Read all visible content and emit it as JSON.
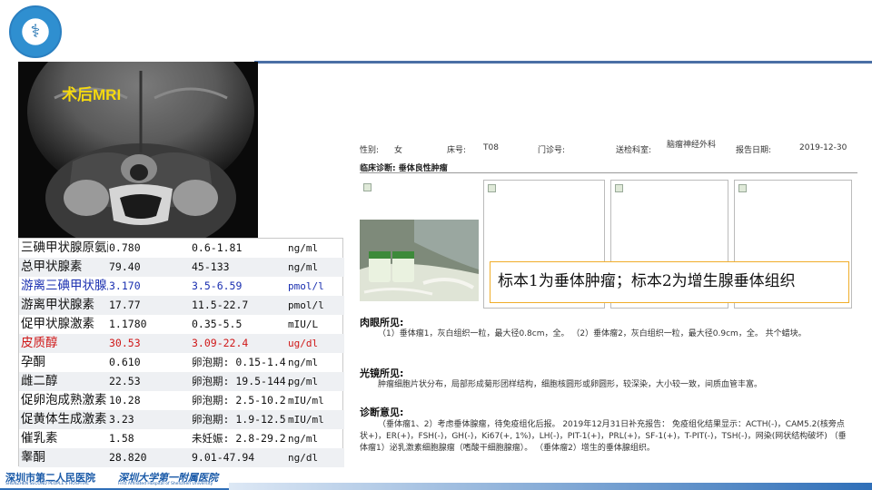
{
  "mri": {
    "title": "术后MRI"
  },
  "lab_rows": [
    {
      "name": "三碘甲状腺原氨酸",
      "value": "0.780",
      "range": "0.6-1.81",
      "unit": "ng/ml",
      "color": "#111111"
    },
    {
      "name": "总甲状腺素",
      "value": "79.40",
      "range": "45-133",
      "unit": "ng/ml",
      "color": "#111111"
    },
    {
      "name": "游离三碘甲状腺原氨酸",
      "value": "3.170",
      "range": "3.5-6.59",
      "unit": "pmol/l",
      "color": "#1a2fb0"
    },
    {
      "name": "游离甲状腺素",
      "value": "17.77",
      "range": "11.5-22.7",
      "unit": "pmol/l",
      "color": "#111111"
    },
    {
      "name": "促甲状腺激素",
      "value": "1.1780",
      "range": "0.35-5.5",
      "unit": "mIU/L",
      "color": "#111111"
    },
    {
      "name": "皮质醇",
      "value": "30.53",
      "range": "3.09-22.4",
      "unit": "ug/dl",
      "color": "#d01818"
    },
    {
      "name": "孕酮",
      "value": "0.610",
      "range": "卵泡期: 0.15-1.4",
      "unit": "ng/ml",
      "color": "#111111"
    },
    {
      "name": "雌二醇",
      "value": "22.53",
      "range": "卵泡期: 19.5-144.",
      "unit": "pg/ml",
      "color": "#111111"
    },
    {
      "name": "促卵泡成熟激素",
      "value": "10.28",
      "range": "卵泡期: 2.5-10.2",
      "unit": "mIU/ml",
      "color": "#111111"
    },
    {
      "name": "促黄体生成激素",
      "value": "3.23",
      "range": "卵泡期: 1.9-12.5",
      "unit": "mIU/ml",
      "color": "#111111"
    },
    {
      "name": "催乳素",
      "value": "1.58",
      "range": "未妊娠: 2.8-29.2",
      "unit": "ng/ml",
      "color": "#111111"
    },
    {
      "name": "睾酮",
      "value": "28.820",
      "range": "9.01-47.94",
      "unit": "ng/dl",
      "color": "#111111"
    }
  ],
  "report": {
    "sex_label": "性别:",
    "sex": "女",
    "bed_label": "床号:",
    "bed": "T08",
    "clinic_label": "门诊号:",
    "clinic": "",
    "dept_label": "送检科室:",
    "dept": "脑瘤神经外科",
    "date_label": "报告日期:",
    "date": "2019-12-30",
    "clinical_diag": "临床诊断: 垂体良性肿瘤",
    "highlight": "标本1为垂体肿瘤；标本2为增生腺垂体组织",
    "gross_title": "肉眼所见:",
    "gross_text": "（1）垂体瘤1，灰白组织一粒，最大径0.8cm，全。 （2）垂体瘤2，灰白组织一粒，最大径0.9cm，全。 共个蜡块。",
    "micro_title": "光镜所见:",
    "micro_text": "肿瘤细胞片状分布，局部形成菊形团样结构，细胞核圆形或卵圆形，较深染，大小较一致，间质血管丰富。",
    "opinion_title": "诊断意见:",
    "opinion_text": "（垂体瘤1、2）考虑垂体腺瘤，待免疫组化后报。 2019年12月31日补充报告： 免疫组化结果显示：ACTH(-)，CAM5.2(核旁点状+)，ER(+)，FSH(-)，GH(-)，Ki67(+, 1%)，LH(-)，PIT-1(+)，PRL(+)，SF-1(+)，T-PIT(-)，TSH(-)，网染(网状结构破坏) （垂体瘤1）泌乳激素细胞腺瘤（嗜酸干细胞腺瘤）。 （垂体瘤2）增生的垂体腺组织。"
  },
  "footer": {
    "hospital1": "深圳市第二人民医院",
    "hospital1_en": "SHENZHEN SECOND PEOPLE'S HOSPITAL",
    "hospital2": "深圳大学第一附属医院",
    "hospital2_en": "First Affiliated Hospital of Shenzhen University"
  }
}
